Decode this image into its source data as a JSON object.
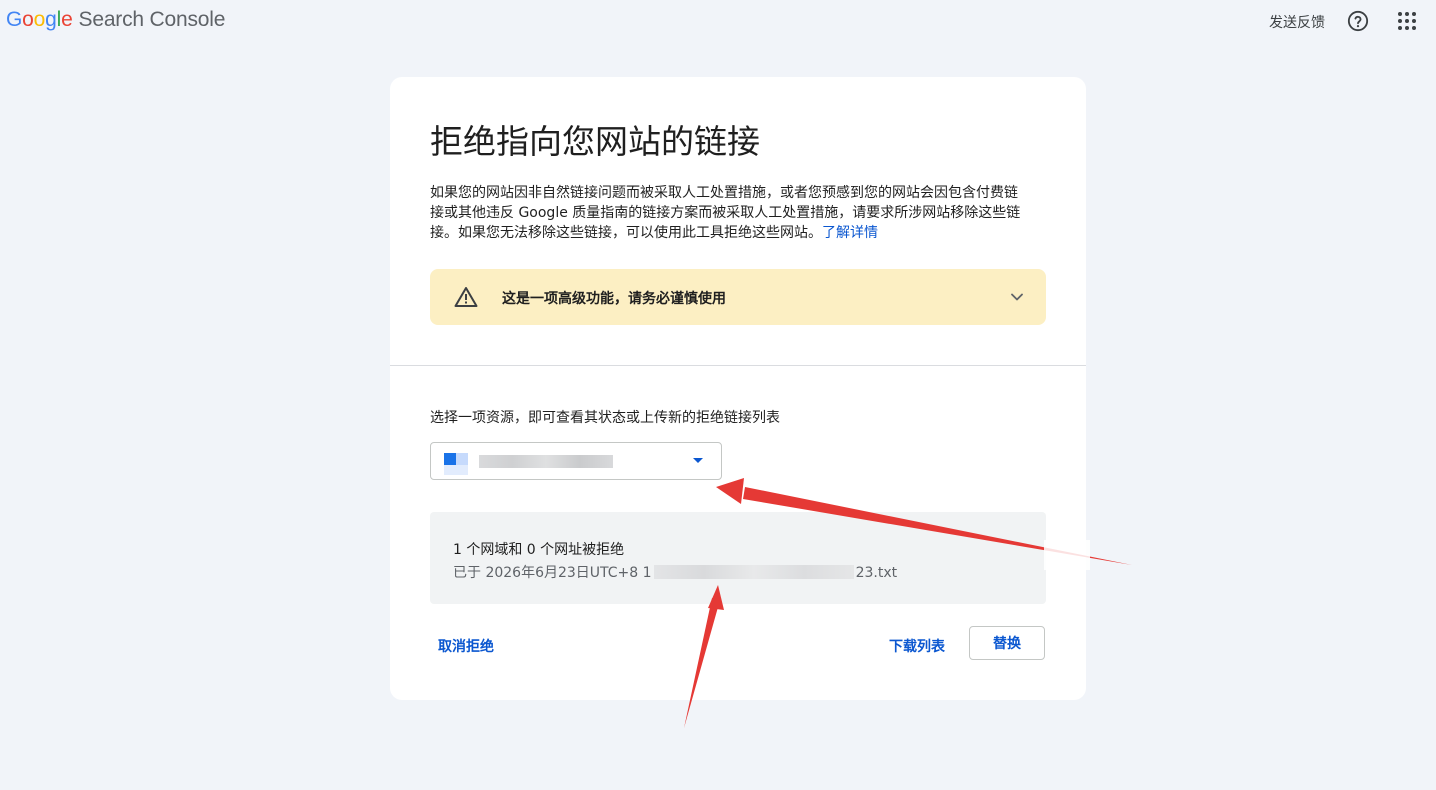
{
  "header": {
    "logo_letters": [
      "G",
      "o",
      "o",
      "g",
      "l",
      "e"
    ],
    "logo_colors": [
      "#4285f4",
      "#ea4335",
      "#fbbc05",
      "#4285f4",
      "#34a853",
      "#ea4335"
    ],
    "product_name": "Search Console",
    "feedback_label": "发送反馈",
    "help_icon": "help-circle-icon",
    "apps_icon": "apps-grid-icon"
  },
  "card": {
    "title": "拒绝指向您网站的链接",
    "description_text": "如果您的网站因非自然链接问题而被采取人工处置措施，或者您预感到您的网站会因包含付费链接或其他违反 Google 质量指南的链接方案而被采取人工处置措施，请要求所涉网站移除这些链接。如果您无法移除这些链接，可以使用此工具拒绝这些网站。",
    "learn_more_label": "了解详情",
    "warning": {
      "icon": "warning-triangle-icon",
      "text": "这是一项高级功能，请务必谨慎使用",
      "expand_icon": "chevron-down-icon"
    },
    "select_label": "选择一项资源，即可查看其状态或上传新的拒绝链接列表",
    "property_select": {
      "selected_value": "",
      "dropdown_icon": "caret-down-icon"
    },
    "status": {
      "summary": "1 个网域和 0 个网址被拒绝",
      "detail_prefix": "已于 2026年6月23日UTC+8 1",
      "detail_suffix": "23.txt"
    },
    "actions": {
      "undo_label": "取消拒绝",
      "download_label": "下载列表",
      "replace_label": "替换"
    }
  },
  "colors": {
    "accent": "#0b57d0",
    "warning_bg": "#fcefc3",
    "page_bg": "#f1f4f9",
    "annotation_arrow": "#e53935"
  }
}
